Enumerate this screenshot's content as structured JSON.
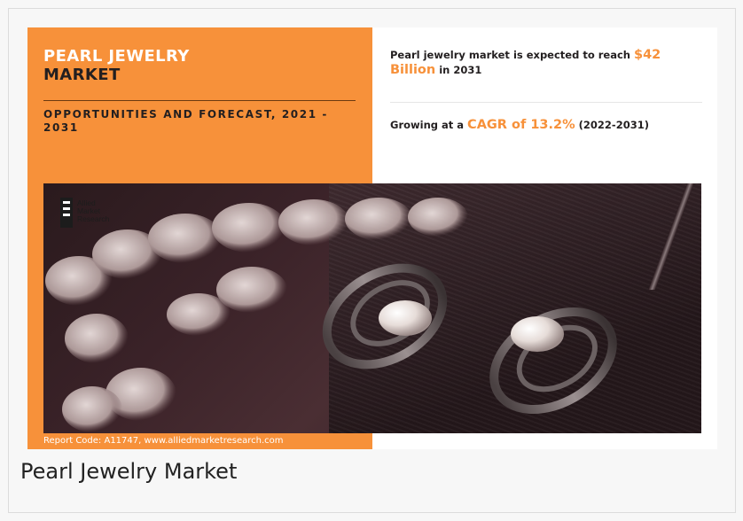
{
  "infographic": {
    "title_line1": "PEARL JEWELRY",
    "title_line2": "MARKET",
    "subtitle": "OPPORTUNITIES AND FORECAST, 2021 - 2031",
    "stat1_prefix": "Pearl jewelry market is expected to reach",
    "stat1_highlight": "$42 Billion",
    "stat1_suffix": "in 2031",
    "stat2_prefix": "Growing at a",
    "stat2_highlight": "CAGR of 13.2%",
    "stat2_suffix": "(2022-2031)",
    "logo_lines": [
      "Allied",
      "Market",
      "Research"
    ],
    "report_code": "Report Code: A11747, www.alliedmarketresearch.com"
  },
  "caption": "Pearl Jewelry Market",
  "colors": {
    "accent": "#f7913a",
    "dark": "#231f20"
  },
  "icons": {
    "logo": "allied-market-research-logo"
  }
}
